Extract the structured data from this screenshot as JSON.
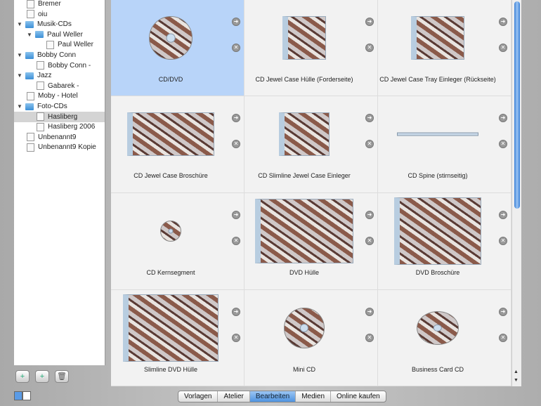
{
  "sidebar": {
    "items": [
      {
        "label": "Bremer",
        "type": "file",
        "level": 1
      },
      {
        "label": "oiu",
        "type": "file",
        "level": 1
      },
      {
        "label": "Musik-CDs",
        "type": "folder",
        "level": 0
      },
      {
        "label": "Paul Weller",
        "type": "folder",
        "level": 1
      },
      {
        "label": "Paul Weller",
        "type": "file",
        "level": 3
      },
      {
        "label": "Bobby Conn",
        "type": "folder",
        "level": 0
      },
      {
        "label": "Bobby Conn -",
        "type": "file",
        "level": 2
      },
      {
        "label": "Jazz",
        "type": "folder",
        "level": 0
      },
      {
        "label": "Gabarek -",
        "type": "file",
        "level": 2
      },
      {
        "label": "Moby - Hotel",
        "type": "file",
        "level": 1
      },
      {
        "label": "Foto-CDs",
        "type": "folder",
        "level": 0
      },
      {
        "label": "Hasliberg",
        "type": "file",
        "level": 2,
        "selected": true
      },
      {
        "label": "Hasliberg 2006",
        "type": "file",
        "level": 2
      },
      {
        "label": "Unbenannt9",
        "type": "file",
        "level": 1
      },
      {
        "label": "Unbenannt9 Kopie",
        "type": "file",
        "level": 1
      }
    ],
    "buttons": [
      "new-document",
      "new-folder",
      "trash"
    ]
  },
  "templates": [
    {
      "label": "CD/DVD",
      "kind": "disc",
      "selected": true
    },
    {
      "label": "CD Jewel Case Hülle (Forderseite)",
      "kind": "case"
    },
    {
      "label": "CD Jewel Case Tray Einleger (Rückseite)",
      "kind": "case"
    },
    {
      "label": "CD Jewel Case Broschüre",
      "kind": "case"
    },
    {
      "label": "CD Slimline Jewel Case Einleger",
      "kind": "case"
    },
    {
      "label": "CD Spine (stirnseitig)",
      "kind": "spine"
    },
    {
      "label": "CD Kernsegment",
      "kind": "disc"
    },
    {
      "label": "DVD Hülle",
      "kind": "case"
    },
    {
      "label": "DVD Broschüre",
      "kind": "case"
    },
    {
      "label": "Slimline DVD Hülle",
      "kind": "case"
    },
    {
      "label": "Mini CD",
      "kind": "disc"
    },
    {
      "label": "Business Card CD",
      "kind": "disc"
    }
  ],
  "icons": {
    "go": "➜",
    "remove": "✕"
  },
  "tabs": [
    {
      "label": "Vorlagen"
    },
    {
      "label": "Atelier"
    },
    {
      "label": "Bearbeiten",
      "active": true
    },
    {
      "label": "Medien"
    },
    {
      "label": "Online kaufen"
    }
  ]
}
